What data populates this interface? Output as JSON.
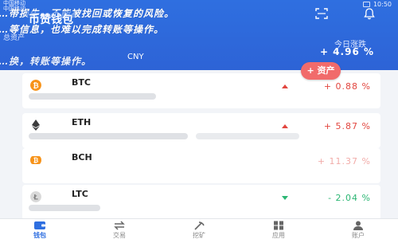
{
  "status_bar": {
    "carrier_1": "中国移动",
    "carrier_2": "中国移动",
    "time": "10:50"
  },
  "overlay_text": {
    "line1": "…带损失，不能被找回或恢复的风险。",
    "line2": "…等信息，也难以完成转账等操作。",
    "line3": "…换，转账等操作。"
  },
  "header": {
    "wallet_name": "币赞钱包",
    "total_label": "总资产",
    "currency": "CNY",
    "change_label": "今日涨跌",
    "change_value": "+ 4.96 %",
    "icons": {
      "scan": "scan-icon",
      "bell": "bell-icon"
    }
  },
  "add_badge": {
    "label": "+ 资产"
  },
  "assets": [
    {
      "symbol": "BTC",
      "icon": "btc-icon",
      "change": "+ 0.88 %",
      "direction": "up",
      "icon_color": "#f7931a"
    },
    {
      "symbol": "ETH",
      "icon": "eth-icon",
      "change": "+ 5.87 %",
      "direction": "up",
      "icon_color": "#3c3c3d"
    },
    {
      "symbol": "BCH",
      "icon": "bch-icon",
      "change": "+ 11.37 %",
      "direction": "up",
      "icon_color": "#f7931a"
    },
    {
      "symbol": "LTC",
      "icon": "ltc-icon",
      "change": "- 2.04 %",
      "direction": "down",
      "icon_color": "#838383"
    }
  ],
  "tabs": [
    {
      "label": "钱包",
      "icon": "wallet-icon",
      "active": true
    },
    {
      "label": "交易",
      "icon": "exchange-icon",
      "active": false
    },
    {
      "label": "挖矿",
      "icon": "mining-icon",
      "active": false
    },
    {
      "label": "应用",
      "icon": "apps-icon",
      "active": false
    },
    {
      "label": "账户",
      "icon": "user-icon",
      "active": false
    }
  ],
  "colors": {
    "primary": "#2f6fe0",
    "up": "#e2463f",
    "down": "#2bb673",
    "badge": "#f16b6b"
  }
}
